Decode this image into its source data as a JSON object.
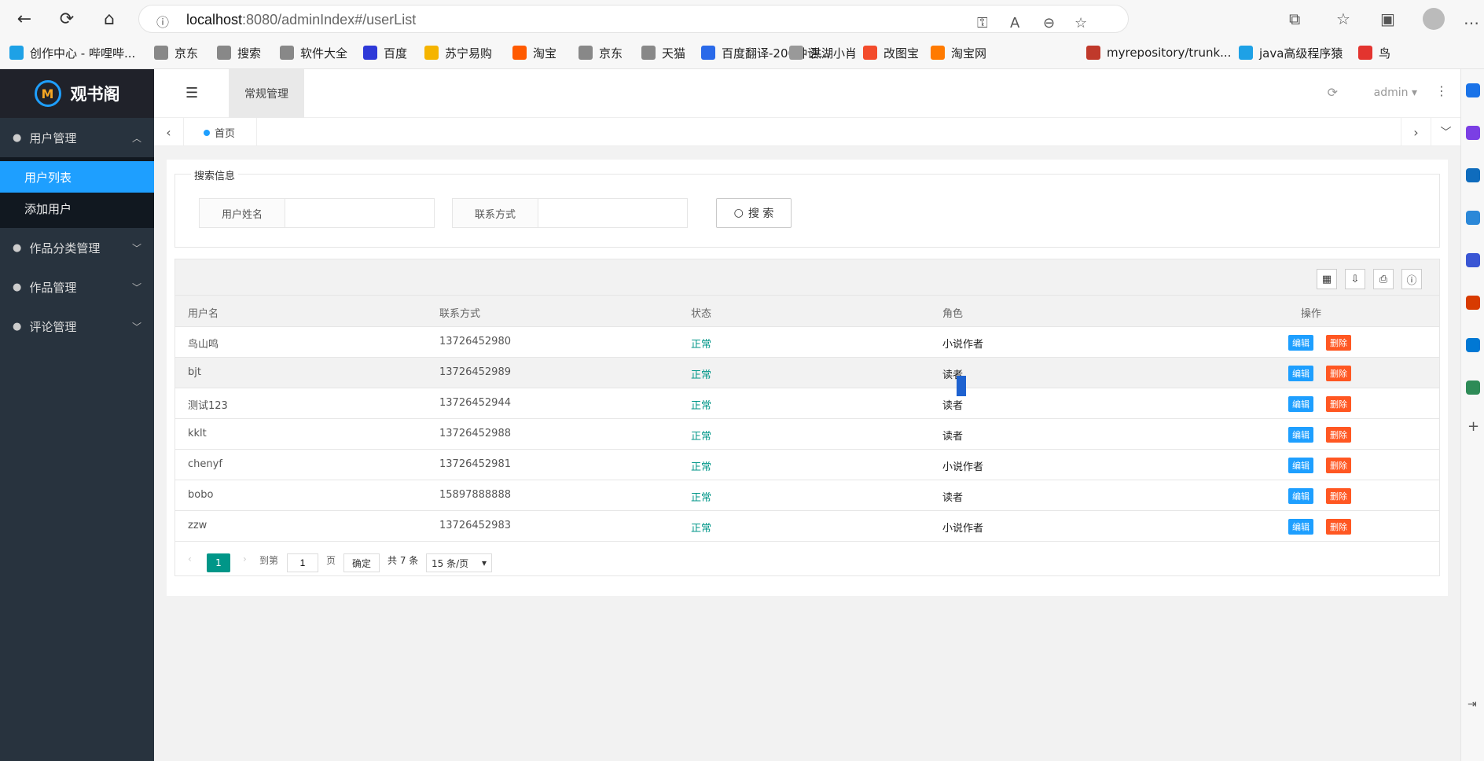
{
  "browser": {
    "url_host": "localhost",
    "url_rest": ":8080/adminIndex#/userList",
    "profile": "avatar"
  },
  "bookmarks": [
    {
      "label": "创作中心 - 哔哩哔...",
      "color": "#1ea1e6"
    },
    {
      "label": "京东",
      "color": "#888"
    },
    {
      "label": "搜索",
      "color": "#888"
    },
    {
      "label": "软件大全",
      "color": "#888"
    },
    {
      "label": "百度",
      "color": "#2e39d8"
    },
    {
      "label": "苏宁易购",
      "color": "#f5b400"
    },
    {
      "label": "淘宝",
      "color": "#ff5a00"
    },
    {
      "label": "京东",
      "color": "#888"
    },
    {
      "label": "天猫",
      "color": "#888"
    },
    {
      "label": "百度翻译-200种语...",
      "color": "#2a6ae9"
    },
    {
      "label": "洪湖小肖",
      "color": "#999"
    },
    {
      "label": "改图宝",
      "color": "#f34c2c"
    },
    {
      "label": "淘宝网",
      "color": "#ff7a00"
    },
    {
      "label": "myrepository/trunk...",
      "color": "#c0392b"
    },
    {
      "label": "java高级程序猿",
      "color": "#1ea1e6"
    },
    {
      "label": "鸟",
      "color": "#e3342f"
    }
  ],
  "sidebar": {
    "logo_text": "观书阁",
    "logo_mark": "M",
    "groups": [
      {
        "label": "用户管理"
      },
      {
        "label": "作品分类管理"
      },
      {
        "label": "作品管理"
      },
      {
        "label": "评论管理"
      }
    ],
    "sub_items": [
      {
        "label": "用户列表"
      },
      {
        "label": "添加用户"
      }
    ]
  },
  "header": {
    "tab_label": "常规管理",
    "user": "admin"
  },
  "tabstrip": {
    "home": "首页"
  },
  "search": {
    "legend": "搜索信息",
    "name_label": "用户姓名",
    "contact_label": "联系方式",
    "button": "搜 索"
  },
  "table": {
    "headers": [
      "用户名",
      "联系方式",
      "状态",
      "角色",
      "操作"
    ],
    "edit_label": "编辑",
    "delete_label": "删除",
    "rows": [
      {
        "name": "鸟山鸣",
        "phone": "13726452980",
        "status": "正常",
        "role": "小说作者"
      },
      {
        "name": "bjt",
        "phone": "13726452989",
        "status": "正常",
        "role": "读者"
      },
      {
        "name": "测试123",
        "phone": "13726452944",
        "status": "正常",
        "role": "读者"
      },
      {
        "name": "kklt",
        "phone": "13726452988",
        "status": "正常",
        "role": "读者"
      },
      {
        "name": "chenyf",
        "phone": "13726452981",
        "status": "正常",
        "role": "小说作者"
      },
      {
        "name": "bobo",
        "phone": "15897888888",
        "status": "正常",
        "role": "读者"
      },
      {
        "name": "zzw",
        "phone": "13726452983",
        "status": "正常",
        "role": "小说作者"
      }
    ]
  },
  "pager": {
    "current": "1",
    "goto": "到第",
    "page_input": "1",
    "page_unit": "页",
    "ok": "确定",
    "total": "共 7 条",
    "page_size": "15 条/页"
  },
  "colors": {
    "primary": "#1e9fff",
    "danger": "#ff5722",
    "success": "#009688",
    "sidebar": "#28333e"
  }
}
